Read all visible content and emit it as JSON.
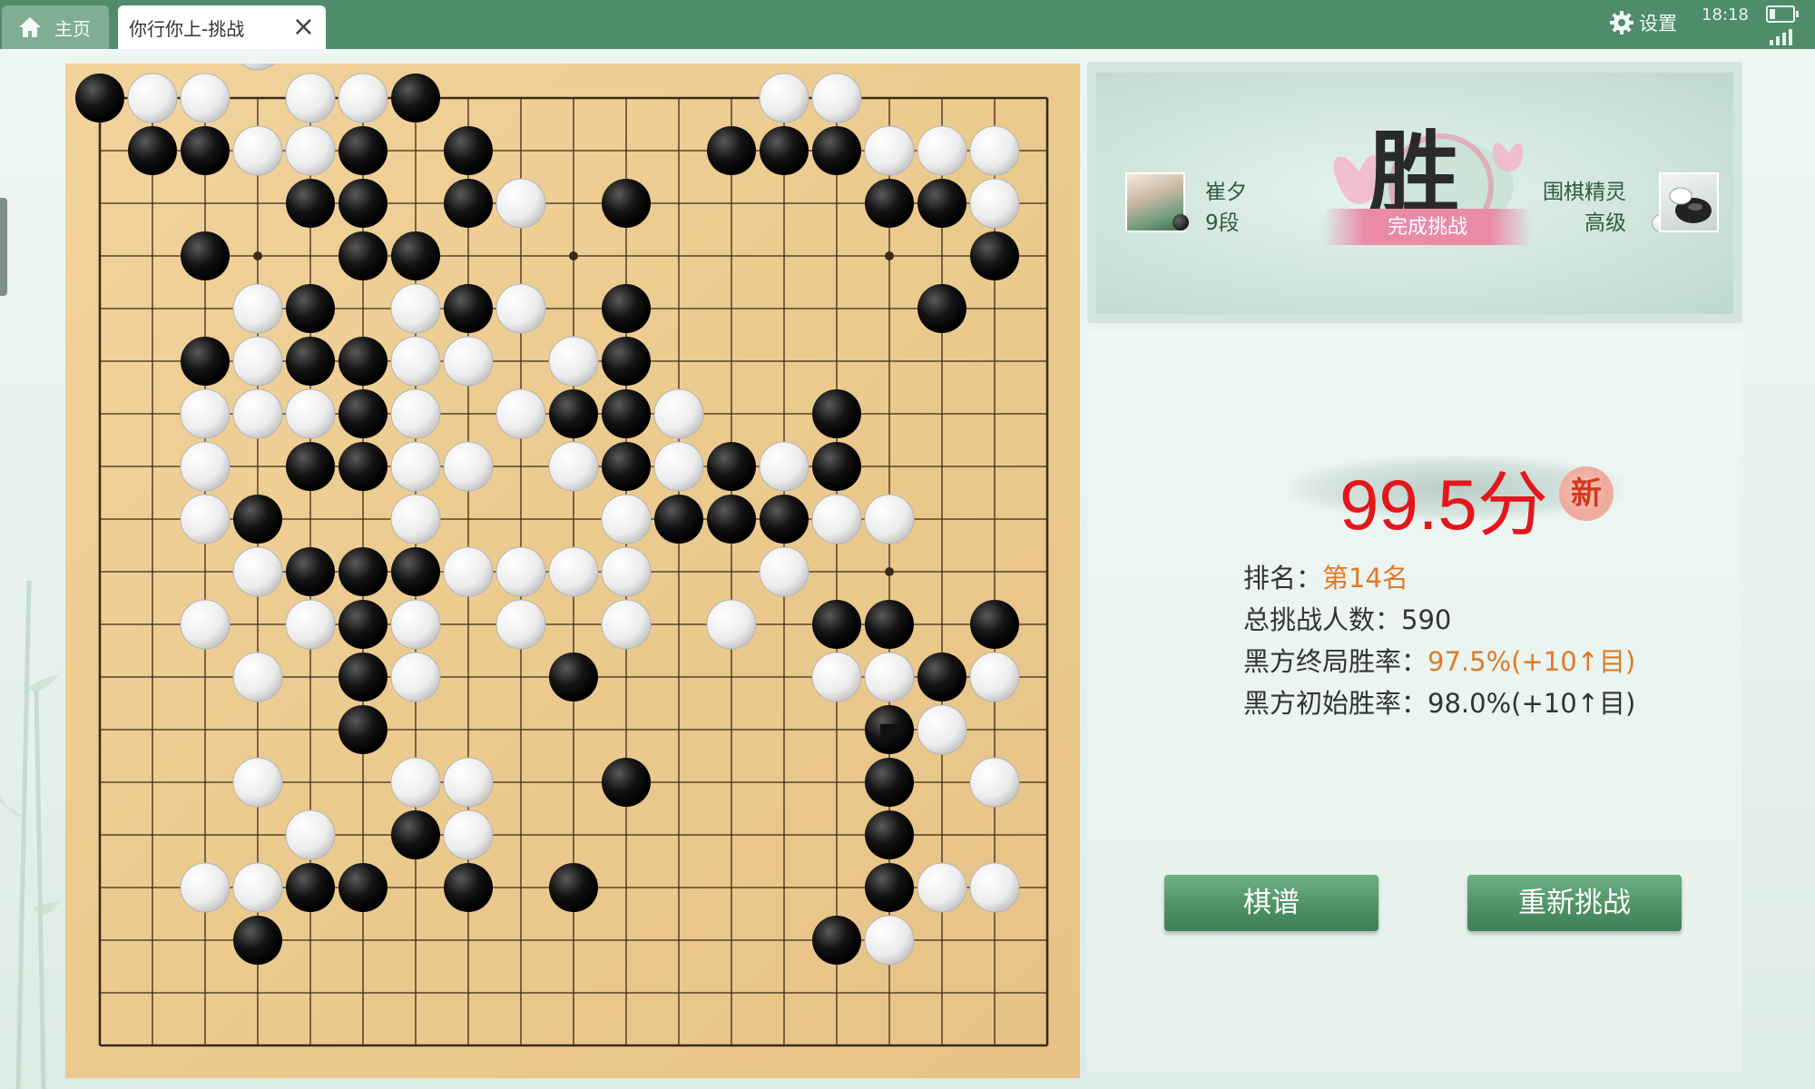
{
  "tabs": [
    {
      "label": "主页",
      "icon": "home-icon"
    },
    {
      "label": "你行你上-挑战",
      "icon": "close-icon"
    }
  ],
  "header": {
    "settings_label": "设置",
    "time": "18:18"
  },
  "result": {
    "player_left": {
      "name": "崔夕",
      "rank": "9段",
      "stone": "black"
    },
    "player_right": {
      "name": "围棋精灵",
      "rank": "高级",
      "stone": "white"
    },
    "badge_char": "胜",
    "badge_text": "完成挑战"
  },
  "score": {
    "value": "99.5",
    "unit": "分",
    "new_badge": "新"
  },
  "stats": {
    "rank_label": "排名：",
    "rank_value": "第14名",
    "total_label": "总挑战人数：",
    "total_value": "590",
    "end_rate_label": "黑方终局胜率：",
    "end_rate_value": "97.5%(+10↑目)",
    "init_rate_label": "黑方初始胜率：",
    "init_rate_value": "98.0%(+10↑目)"
  },
  "buttons": {
    "record": "棋谱",
    "retry": "重新挑战"
  },
  "colors": {
    "topbar": "#4e8c6a",
    "accent_red": "#e3161b",
    "accent_orange": "#e07a27",
    "button_green": "#4f9266"
  },
  "board": {
    "size": 19,
    "last_move": {
      "col": 15,
      "row": 12
    },
    "black": [
      [
        0,
        0
      ],
      [
        6,
        0
      ],
      [
        1,
        1
      ],
      [
        2,
        1
      ],
      [
        5,
        1
      ],
      [
        7,
        1
      ],
      [
        12,
        1
      ],
      [
        13,
        1
      ],
      [
        14,
        1
      ],
      [
        4,
        2
      ],
      [
        5,
        2
      ],
      [
        7,
        2
      ],
      [
        10,
        2
      ],
      [
        15,
        2
      ],
      [
        16,
        2
      ],
      [
        2,
        3
      ],
      [
        5,
        3
      ],
      [
        6,
        3
      ],
      [
        17,
        3
      ],
      [
        4,
        4
      ],
      [
        7,
        4
      ],
      [
        10,
        4
      ],
      [
        16,
        4
      ],
      [
        2,
        5
      ],
      [
        4,
        5
      ],
      [
        5,
        5
      ],
      [
        10,
        5
      ],
      [
        5,
        6
      ],
      [
        9,
        6
      ],
      [
        10,
        6
      ],
      [
        14,
        6
      ],
      [
        4,
        7
      ],
      [
        5,
        7
      ],
      [
        10,
        7
      ],
      [
        12,
        7
      ],
      [
        14,
        7
      ],
      [
        3,
        8
      ],
      [
        11,
        8
      ],
      [
        12,
        8
      ],
      [
        13,
        8
      ],
      [
        4,
        9
      ],
      [
        5,
        9
      ],
      [
        6,
        9
      ],
      [
        5,
        10
      ],
      [
        14,
        10
      ],
      [
        15,
        10
      ],
      [
        17,
        10
      ],
      [
        5,
        11
      ],
      [
        9,
        11
      ],
      [
        16,
        11
      ],
      [
        5,
        12
      ],
      [
        15,
        12
      ],
      [
        10,
        13
      ],
      [
        15,
        13
      ],
      [
        6,
        14
      ],
      [
        15,
        14
      ],
      [
        4,
        15
      ],
      [
        5,
        15
      ],
      [
        7,
        15
      ],
      [
        9,
        15
      ],
      [
        15,
        15
      ],
      [
        3,
        16
      ],
      [
        14,
        16
      ]
    ],
    "white": [
      [
        3,
        -1
      ],
      [
        1,
        0
      ],
      [
        2,
        0
      ],
      [
        4,
        0
      ],
      [
        5,
        0
      ],
      [
        13,
        0
      ],
      [
        14,
        0
      ],
      [
        3,
        1
      ],
      [
        4,
        1
      ],
      [
        15,
        1
      ],
      [
        16,
        1
      ],
      [
        17,
        1
      ],
      [
        8,
        2
      ],
      [
        17,
        2
      ],
      [
        3,
        4
      ],
      [
        6,
        4
      ],
      [
        8,
        4
      ],
      [
        3,
        5
      ],
      [
        6,
        5
      ],
      [
        7,
        5
      ],
      [
        9,
        5
      ],
      [
        2,
        6
      ],
      [
        3,
        6
      ],
      [
        4,
        6
      ],
      [
        6,
        6
      ],
      [
        8,
        6
      ],
      [
        11,
        6
      ],
      [
        2,
        7
      ],
      [
        6,
        7
      ],
      [
        7,
        7
      ],
      [
        9,
        7
      ],
      [
        11,
        7
      ],
      [
        13,
        7
      ],
      [
        2,
        8
      ],
      [
        6,
        8
      ],
      [
        10,
        8
      ],
      [
        14,
        8
      ],
      [
        15,
        8
      ],
      [
        3,
        9
      ],
      [
        7,
        9
      ],
      [
        8,
        9
      ],
      [
        9,
        9
      ],
      [
        10,
        9
      ],
      [
        13,
        9
      ],
      [
        2,
        10
      ],
      [
        4,
        10
      ],
      [
        6,
        10
      ],
      [
        8,
        10
      ],
      [
        10,
        10
      ],
      [
        12,
        10
      ],
      [
        3,
        11
      ],
      [
        6,
        11
      ],
      [
        14,
        11
      ],
      [
        15,
        11
      ],
      [
        17,
        11
      ],
      [
        16,
        12
      ],
      [
        3,
        13
      ],
      [
        6,
        13
      ],
      [
        7,
        13
      ],
      [
        17,
        13
      ],
      [
        4,
        14
      ],
      [
        7,
        14
      ],
      [
        2,
        15
      ],
      [
        3,
        15
      ],
      [
        16,
        15
      ],
      [
        17,
        15
      ],
      [
        15,
        16
      ]
    ]
  }
}
